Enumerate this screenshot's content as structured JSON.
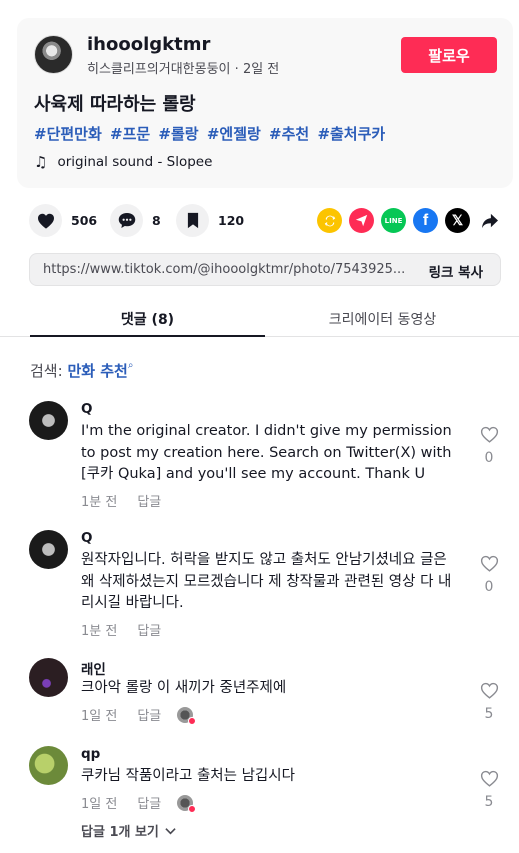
{
  "post": {
    "username": "ihooolgktmr",
    "nickname": "히스클리프의거대한몽둥이",
    "time_ago": "2일 전",
    "follow_label": "팔로우",
    "title": "사육제 따라하는 롤랑",
    "hashtags": [
      "#단편만화",
      "#프문",
      "#롤랑",
      "#엔젤랑",
      "#추천",
      "#출처쿠카"
    ],
    "sound": "original sound - Slopee"
  },
  "actions": {
    "likes": "506",
    "comments": "8",
    "saves": "120"
  },
  "share": {
    "icons": [
      "repost-icon",
      "send-icon",
      "line-icon",
      "facebook-icon",
      "x-icon",
      "share-arrow-icon"
    ],
    "colors": {
      "repost": "#fcc400",
      "send": "#fe2c55",
      "line": "#06c755",
      "facebook": "#1877f2",
      "x": "#000000"
    },
    "url": "https://www.tiktok.com/@ihooolgktmr/photo/7543925...",
    "copy_label": "링크 복사"
  },
  "tabs": {
    "comments": "댓글 (8)",
    "creator_videos": "크리에이터 동영상"
  },
  "search": {
    "label": "검색:",
    "query": "만화 추천"
  },
  "comments": [
    {
      "name": "Q",
      "text": "I'm the original creator. I didn't give my permission to post my creation here. Search on Twitter(X) with [쿠카 Quka] and you'll see my account. Thank U",
      "time": "1분 전",
      "reply": "답글",
      "likes": "0"
    },
    {
      "name": "Q",
      "text": "원작자입니다. 허락을 받지도 않고 출처도 안남기셨네요 글은 왜 삭제하셨는지 모르겠습니다 제 창작물과 관련된 영상 다 내리시길 바랍니다.",
      "time": "1분 전",
      "reply": "답글",
      "likes": "0"
    },
    {
      "name": "래인",
      "text": "크아악 롤랑 이 새끼가 중년주제에",
      "time": "1일 전",
      "reply": "답글",
      "likes": "5"
    },
    {
      "name": "qp",
      "text": "쿠카님 작품이라고 출처는 남깁시다",
      "time": "1일 전",
      "reply": "답글",
      "likes": "5"
    }
  ],
  "view_replies": "답글 1개 보기",
  "accent_color": "#fe2c55",
  "link_color": "#2b5db9"
}
